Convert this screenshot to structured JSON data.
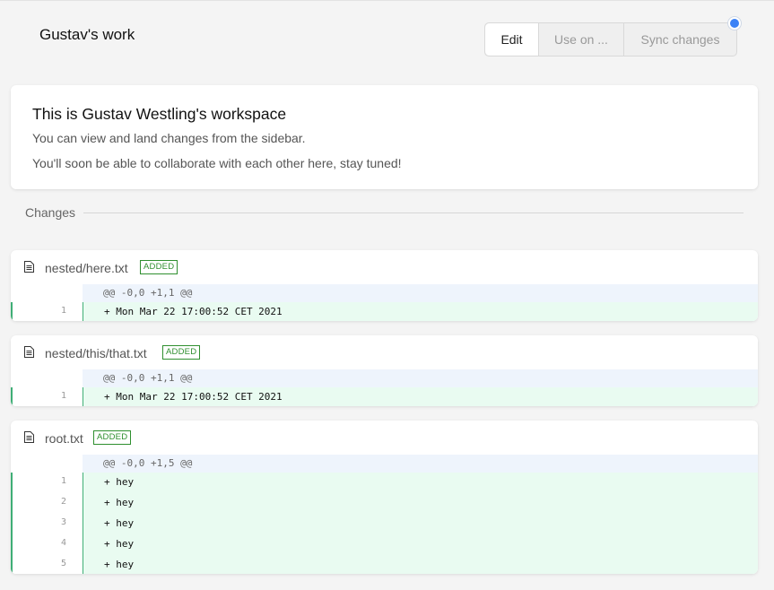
{
  "header": {
    "title": "Gustav's work",
    "buttons": {
      "edit": "Edit",
      "use_on": "Use on ...",
      "sync": "Sync changes"
    },
    "status_dot_color": "#3b82f6"
  },
  "intro": {
    "title": "This is Gustav Westling's workspace",
    "line1": "You can view and land changes from the sidebar.",
    "line2": "You'll soon be able to collaborate with each other here, stay tuned!"
  },
  "changes_label": "Changes",
  "files": [
    {
      "name": "nested/here.txt",
      "badge": "ADDED",
      "hunk": "@@ -0,0 +1,1 @@",
      "lines": [
        {
          "num": "1",
          "text": "+ Mon Mar 22 17:00:52 CET 2021"
        }
      ]
    },
    {
      "name": "nested/this/that.txt",
      "badge": "ADDED",
      "hunk": "@@ -0,0 +1,1 @@",
      "lines": [
        {
          "num": "1",
          "text": "+ Mon Mar 22 17:00:52 CET 2021"
        }
      ]
    },
    {
      "name": "root.txt",
      "badge": "ADDED",
      "hunk": "@@ -0,0 +1,5 @@",
      "lines": [
        {
          "num": "1",
          "text": "+ hey"
        },
        {
          "num": "2",
          "text": "+ hey"
        },
        {
          "num": "3",
          "text": "+ hey"
        },
        {
          "num": "4",
          "text": "+ hey"
        },
        {
          "num": "5",
          "text": "+ hey"
        }
      ]
    }
  ]
}
